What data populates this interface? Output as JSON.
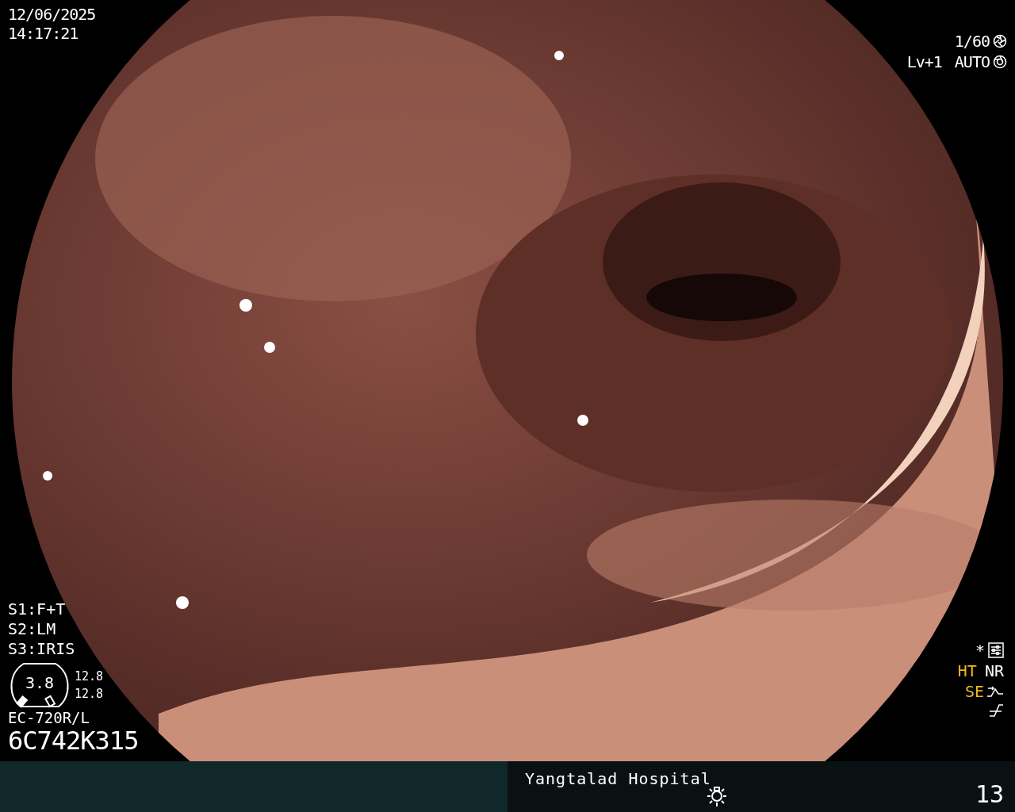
{
  "datetime": {
    "date": "12/06/2025",
    "time": "14:17:21"
  },
  "exposure": {
    "shutter": "1/60",
    "level": "Lv+1",
    "iris": "AUTO"
  },
  "switches": [
    "S1:F+T",
    "S2:LM",
    "S3:IRIS"
  ],
  "zoom_gauge": {
    "value": "3.8",
    "readings": [
      "12.8",
      "12.8"
    ]
  },
  "scope": {
    "model": "EC-720R/L",
    "serial": "6C742K315"
  },
  "marker": "*",
  "indicators": [
    {
      "label": "HT",
      "color": "#f2b81c"
    },
    {
      "label": "NR",
      "color": "#ffffff"
    },
    {
      "label": "SE",
      "color": "#f2b81c"
    }
  ],
  "status_bar": {
    "institution": "Yangtalad Hospital",
    "number": "13"
  }
}
